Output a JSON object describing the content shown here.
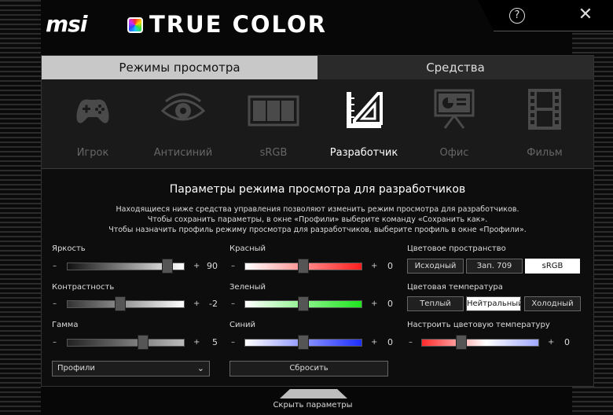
{
  "app": {
    "brand": "msi",
    "product": "TRUE COLOR"
  },
  "window_controls": {
    "help": "?",
    "close": "✕"
  },
  "tabs": [
    {
      "label": "Режимы просмотра",
      "active": true
    },
    {
      "label": "Средства",
      "active": false
    }
  ],
  "modes": [
    {
      "label": "Игрок",
      "icon": "gamepad-icon",
      "active": false
    },
    {
      "label": "Антисиний",
      "icon": "eye-icon",
      "active": false
    },
    {
      "label": "sRGB",
      "icon": "srgb-icon",
      "active": false
    },
    {
      "label": "Разработчик",
      "icon": "ruler-triangle-icon",
      "active": true
    },
    {
      "label": "Офис",
      "icon": "presentation-icon",
      "active": false
    },
    {
      "label": "Фильм",
      "icon": "film-icon",
      "active": false
    }
  ],
  "settings": {
    "title": "Параметры режима просмотра для разработчиков",
    "description": [
      "Находящиеся ниже средства управления позволяют изменить режим просмотра для разработчиков.",
      "Чтобы сохранить параметры, в окне «Профили» выберите команду «Сохранить как».",
      "Чтобы назначить профиль режиму просмотра для разработчиков, выберите профиль в окне «Профили»."
    ]
  },
  "sliders": {
    "brightness": {
      "label": "Яркость",
      "value": "90",
      "fraction": 0.86
    },
    "contrast": {
      "label": "Контрастность",
      "value": "-2",
      "fraction": 0.45
    },
    "gamma": {
      "label": "Гамма",
      "value": "5",
      "fraction": 0.65
    },
    "red": {
      "label": "Красный",
      "value": "0",
      "fraction": 0.5
    },
    "green": {
      "label": "Зеленый",
      "value": "0",
      "fraction": 0.5
    },
    "blue": {
      "label": "Синий",
      "value": "0",
      "fraction": 0.5
    },
    "color_temp": {
      "label": "Настроить цветовую температуру",
      "value": "0",
      "fraction": 0.34
    }
  },
  "slider_signs": {
    "minus": "–",
    "plus": "+"
  },
  "color_space": {
    "label": "Цветовое пространство",
    "options": [
      "Исходный",
      "Зап. 709",
      "sRGB"
    ],
    "selected": "sRGB"
  },
  "color_temperature": {
    "label": "Цветовая температура",
    "options": [
      "Теплый",
      "Нейтральный",
      "Холодный"
    ],
    "selected": "Нейтральный"
  },
  "profiles": {
    "value": "Профили",
    "chevron": "⌄"
  },
  "reset_label": "Сбросить",
  "hide_label": "Скрыть параметры",
  "colors": {
    "active_tab": "#c8c8c8",
    "panel": "#0d0d0d"
  }
}
